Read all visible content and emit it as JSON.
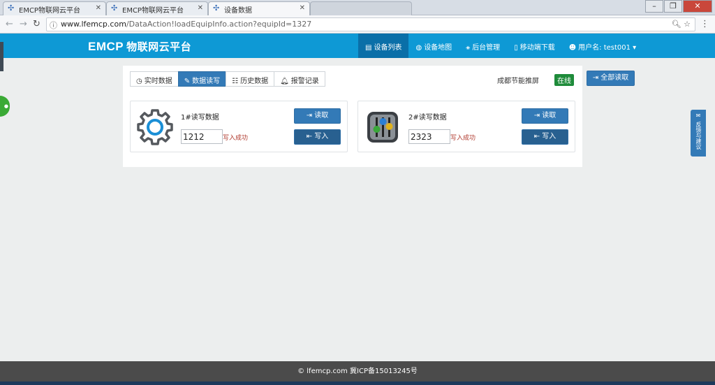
{
  "browser": {
    "tabs": [
      {
        "title": "EMCP物联网云平台",
        "active": false
      },
      {
        "title": "EMCP物联网云平台",
        "active": false
      },
      {
        "title": "设备数据",
        "active": true
      }
    ],
    "url_domain": "www.lfemcp.com",
    "url_path": "/DataAction!loadEquipInfo.action?equipId=1327"
  },
  "header": {
    "logo": "EMCP",
    "logo_sub": "物联网云平台",
    "nav": [
      {
        "label": "设备列表",
        "icon": "list-icon",
        "active": true
      },
      {
        "label": "设备地图",
        "icon": "globe-icon",
        "active": false
      },
      {
        "label": "后台管理",
        "icon": "sitemap-icon",
        "active": false
      },
      {
        "label": "移动端下载",
        "icon": "mobile-icon",
        "active": false
      },
      {
        "label": "用户名: test001 ▾",
        "icon": "user-icon",
        "active": false
      }
    ]
  },
  "subtabs": [
    {
      "label": "实时数据",
      "icon": "clock-icon",
      "active": false
    },
    {
      "label": "数据读写",
      "icon": "pencil-icon",
      "active": true
    },
    {
      "label": "历史数据",
      "icon": "table-icon",
      "active": false
    },
    {
      "label": "报警记录",
      "icon": "bell-icon",
      "active": false
    }
  ],
  "device": {
    "name": "成都节能推屏",
    "status": "在线"
  },
  "read_all_label": "全部读取",
  "cards": [
    {
      "title": "1#读写数据",
      "value": "1212",
      "status": "写入成功",
      "read_label": "读取",
      "write_label": "写入",
      "icon": "gear-icon"
    },
    {
      "title": "2#读写数据",
      "value": "2323",
      "status": "写入成功",
      "read_label": "读取",
      "write_label": "写入",
      "icon": "equalizer-icon"
    }
  ],
  "feedback_label": "反馈与建议",
  "footer_text": "lfemcp.com 冀ICP备15013245号",
  "colors": {
    "header": "#0e99d5",
    "primary": "#337ab7",
    "online": "#1e8b3a",
    "footer": "#4b4b4b"
  }
}
